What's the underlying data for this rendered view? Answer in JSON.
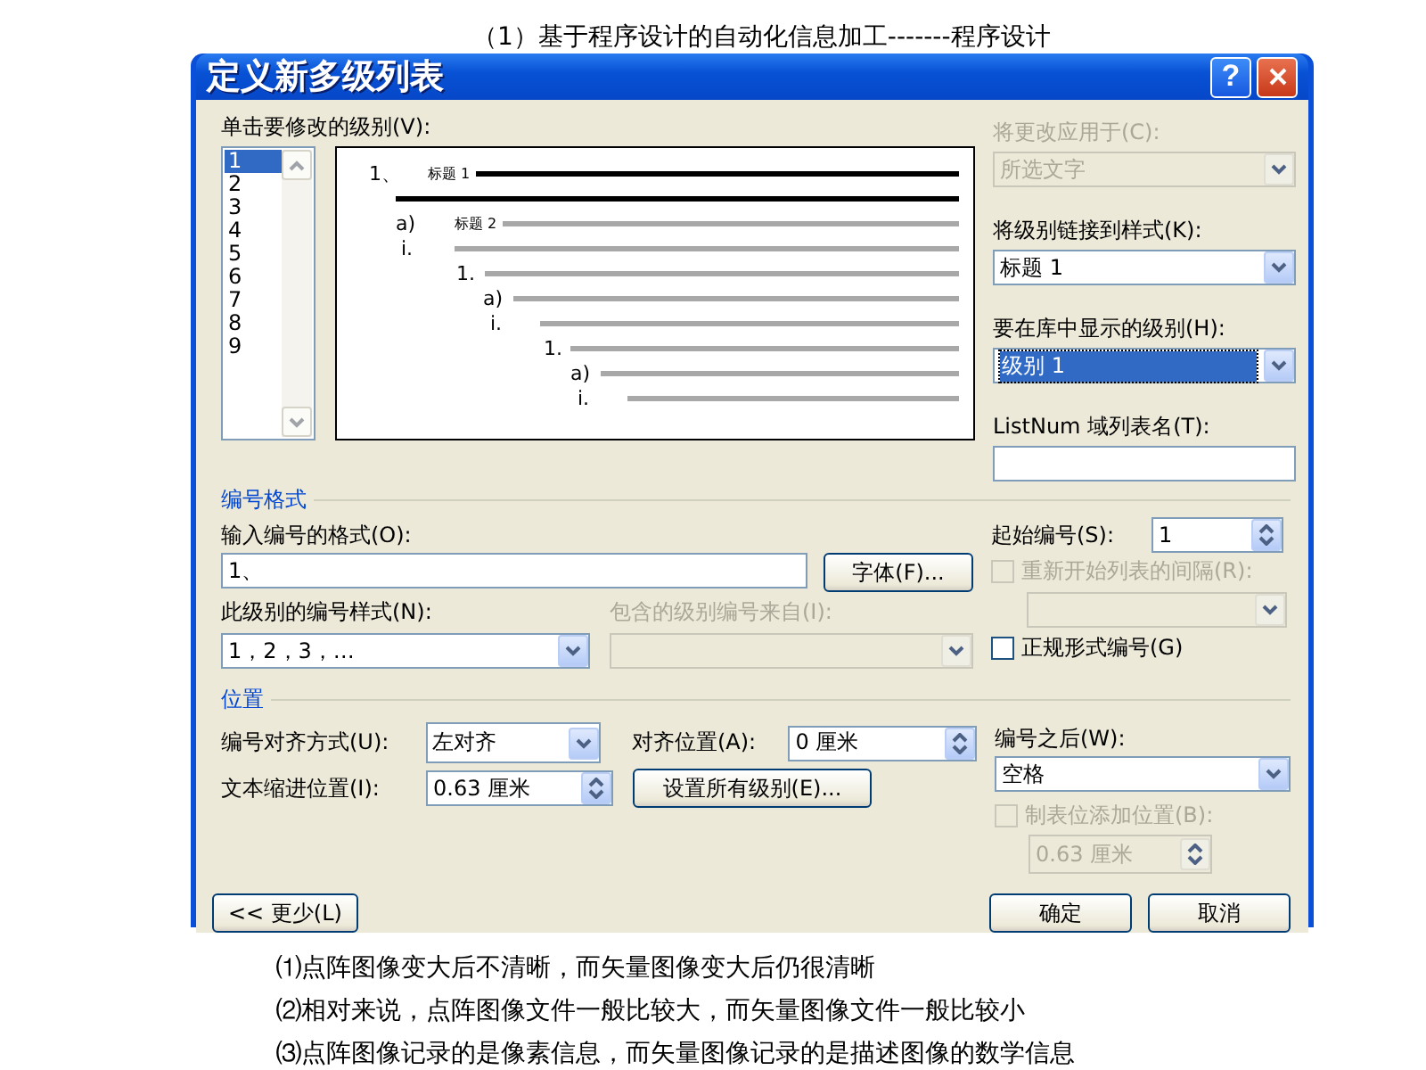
{
  "document": {
    "lines_above": [
      "（1）基于程序设计的自动化信息加工-------程序设计"
    ],
    "lines_below": [
      "⑴点阵图像变大后不清晰，而矢量图像变大后仍很清晰",
      "⑵相对来说，点阵图像文件一般比较大，而矢量图像文件一般比较小",
      "⑶点阵图像记录的是像素信息，而矢量图像记录的是描述图像的数学信息"
    ]
  },
  "dialog": {
    "title": "定义新多级列表",
    "help_button": "?",
    "level_list": {
      "label": "单击要修改的级别(V):",
      "items": [
        {
          "label": "1",
          "selected": true
        },
        {
          "label": "2",
          "selected": false
        },
        {
          "label": "3",
          "selected": false
        },
        {
          "label": "4",
          "selected": false
        },
        {
          "label": "5",
          "selected": false
        },
        {
          "label": "6",
          "selected": false
        },
        {
          "label": "7",
          "selected": false
        },
        {
          "label": "8",
          "selected": false
        },
        {
          "label": "9",
          "selected": false
        }
      ]
    },
    "preview": {
      "rows": [
        {
          "number": "1、",
          "style": "标题 1",
          "highlighted": true
        },
        {
          "highlighted": true
        },
        {
          "number": "a)",
          "style": "标题 2",
          "highlighted": false
        },
        {
          "number": "i.",
          "highlighted": false
        },
        {
          "number": "1.",
          "highlighted": false
        },
        {
          "number": "a)",
          "highlighted": false
        },
        {
          "number": "i.",
          "highlighted": false
        },
        {
          "number": "1.",
          "highlighted": false
        },
        {
          "number": "a)",
          "highlighted": false
        },
        {
          "number": "i.",
          "highlighted": false
        }
      ]
    },
    "apply_to": {
      "label": "将更改应用于(C):",
      "value": "所选文字",
      "disabled": true
    },
    "link_style": {
      "label": "将级别链接到样式(K):",
      "value": "标题 1",
      "disabled": false
    },
    "gallery_level": {
      "label": "要在库中显示的级别(H):",
      "value": "级别 1",
      "disabled": false
    },
    "listnum": {
      "label": "ListNum 域列表名(T):"
    },
    "number_format": {
      "title": "编号格式",
      "format_input": {
        "label": "输入编号的格式(O):",
        "value": "1、"
      },
      "font_button": "字体(F)...",
      "number_style": {
        "label": "此级别的编号样式(N):",
        "value": "1，2，3，…",
        "disabled": false
      },
      "include_from": {
        "label": "包含的级别编号来自(I):",
        "disabled": true
      },
      "start_at": {
        "label": "起始编号(S):",
        "value": "1"
      },
      "restart": {
        "label": "重新开始列表的间隔(R):",
        "checked": false,
        "disabled": true
      },
      "legal": {
        "label": "正规形式编号(G)",
        "checked": false,
        "disabled": false
      }
    },
    "position": {
      "title": "位置",
      "alignment": {
        "label": "编号对齐方式(U):",
        "value": "左对齐",
        "disabled": false
      },
      "aligned_at": {
        "label": "对齐位置(A):",
        "value": "0 厘米"
      },
      "indent_at": {
        "label": "文本缩进位置(I):",
        "value": "0.63 厘米"
      },
      "set_all_button": "设置所有级别(E)...",
      "follow_number": {
        "label": "编号之后(W):",
        "value": "空格",
        "disabled": false
      },
      "tab_stop": {
        "label": "制表位添加位置(B):",
        "checked": false,
        "disabled": true,
        "value": "0.63 厘米"
      }
    },
    "less_button": "<< 更少(L)",
    "ok_button": "确定",
    "cancel_button": "取消"
  }
}
